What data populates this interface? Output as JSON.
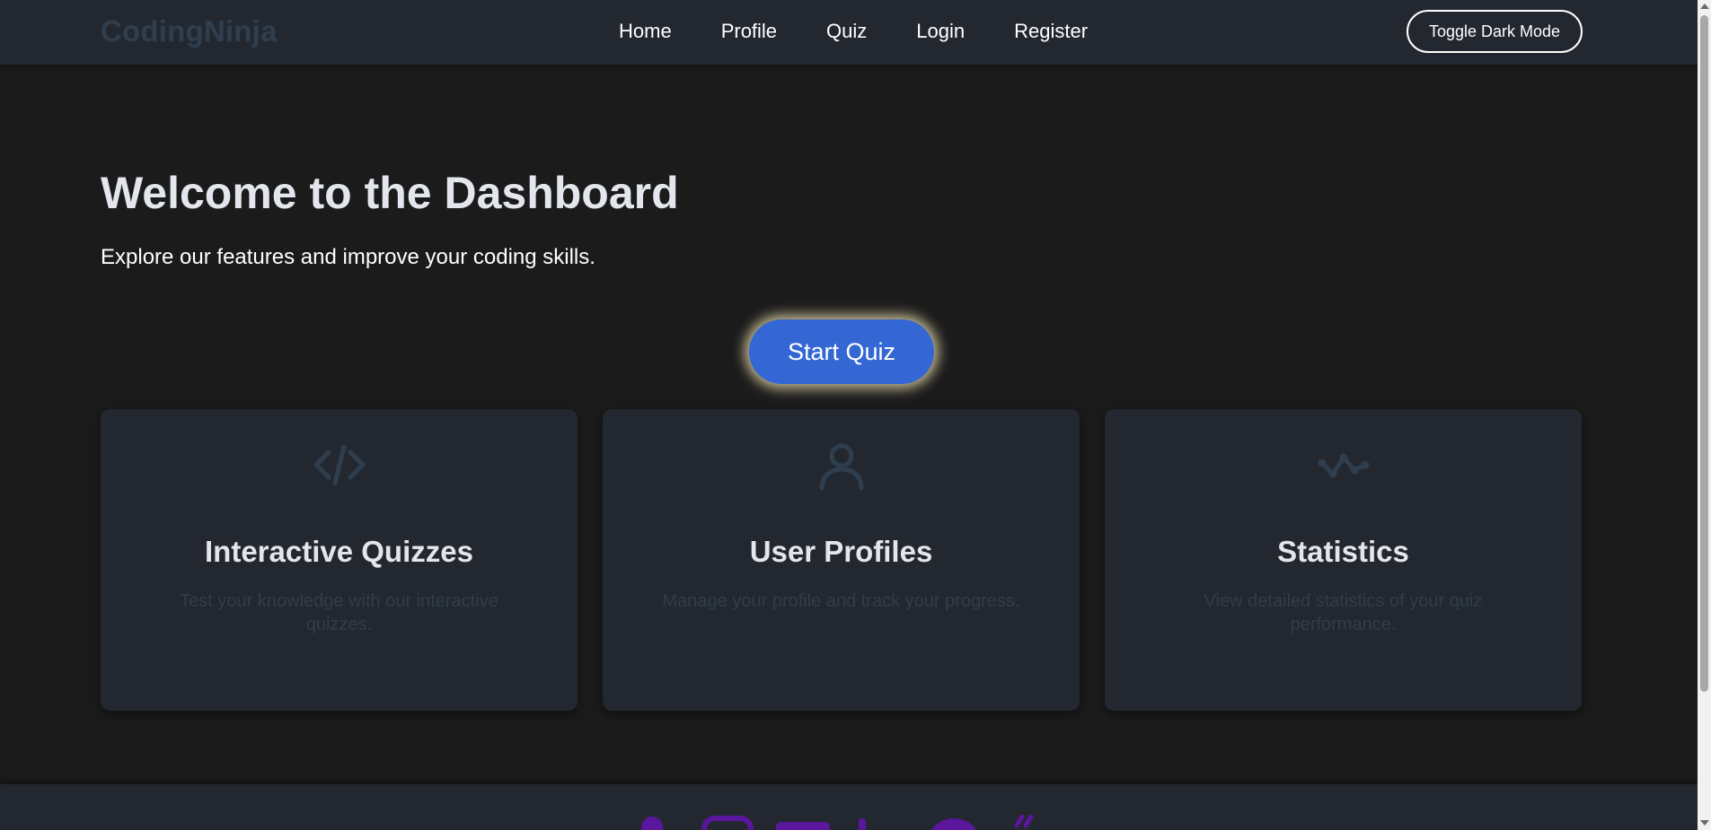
{
  "nav": {
    "brand": "CodingNinja",
    "links": [
      "Home",
      "Profile",
      "Quiz",
      "Login",
      "Register"
    ],
    "toggle_label": "Toggle Dark Mode"
  },
  "hero": {
    "title": "Welcome to the Dashboard",
    "subtitle": "Explore our features and improve your coding skills.",
    "cta_label": "Start Quiz"
  },
  "cards": [
    {
      "icon": "code-icon",
      "title": "Interactive Quizzes",
      "text": "Test your knowledge with our interactive quizzes."
    },
    {
      "icon": "user-icon",
      "title": "User Profiles",
      "text": "Manage your profile and track your progress."
    },
    {
      "icon": "stats-icon",
      "title": "Statistics",
      "text": "View detailed statistics of your quiz performance."
    }
  ],
  "footer": {
    "icons": [
      "social-icon-1",
      "social-icon-2",
      "social-icon-3",
      "social-icon-4",
      "social-icon-5",
      "social-icon-6"
    ]
  },
  "colors": {
    "page_background": "#1b1b1b",
    "surface": "#232830",
    "brand_text": "#2f3e4e",
    "primary_button": "#3467d3",
    "card_text": "#2f3d4c",
    "footer_icons": "#5a169c"
  }
}
